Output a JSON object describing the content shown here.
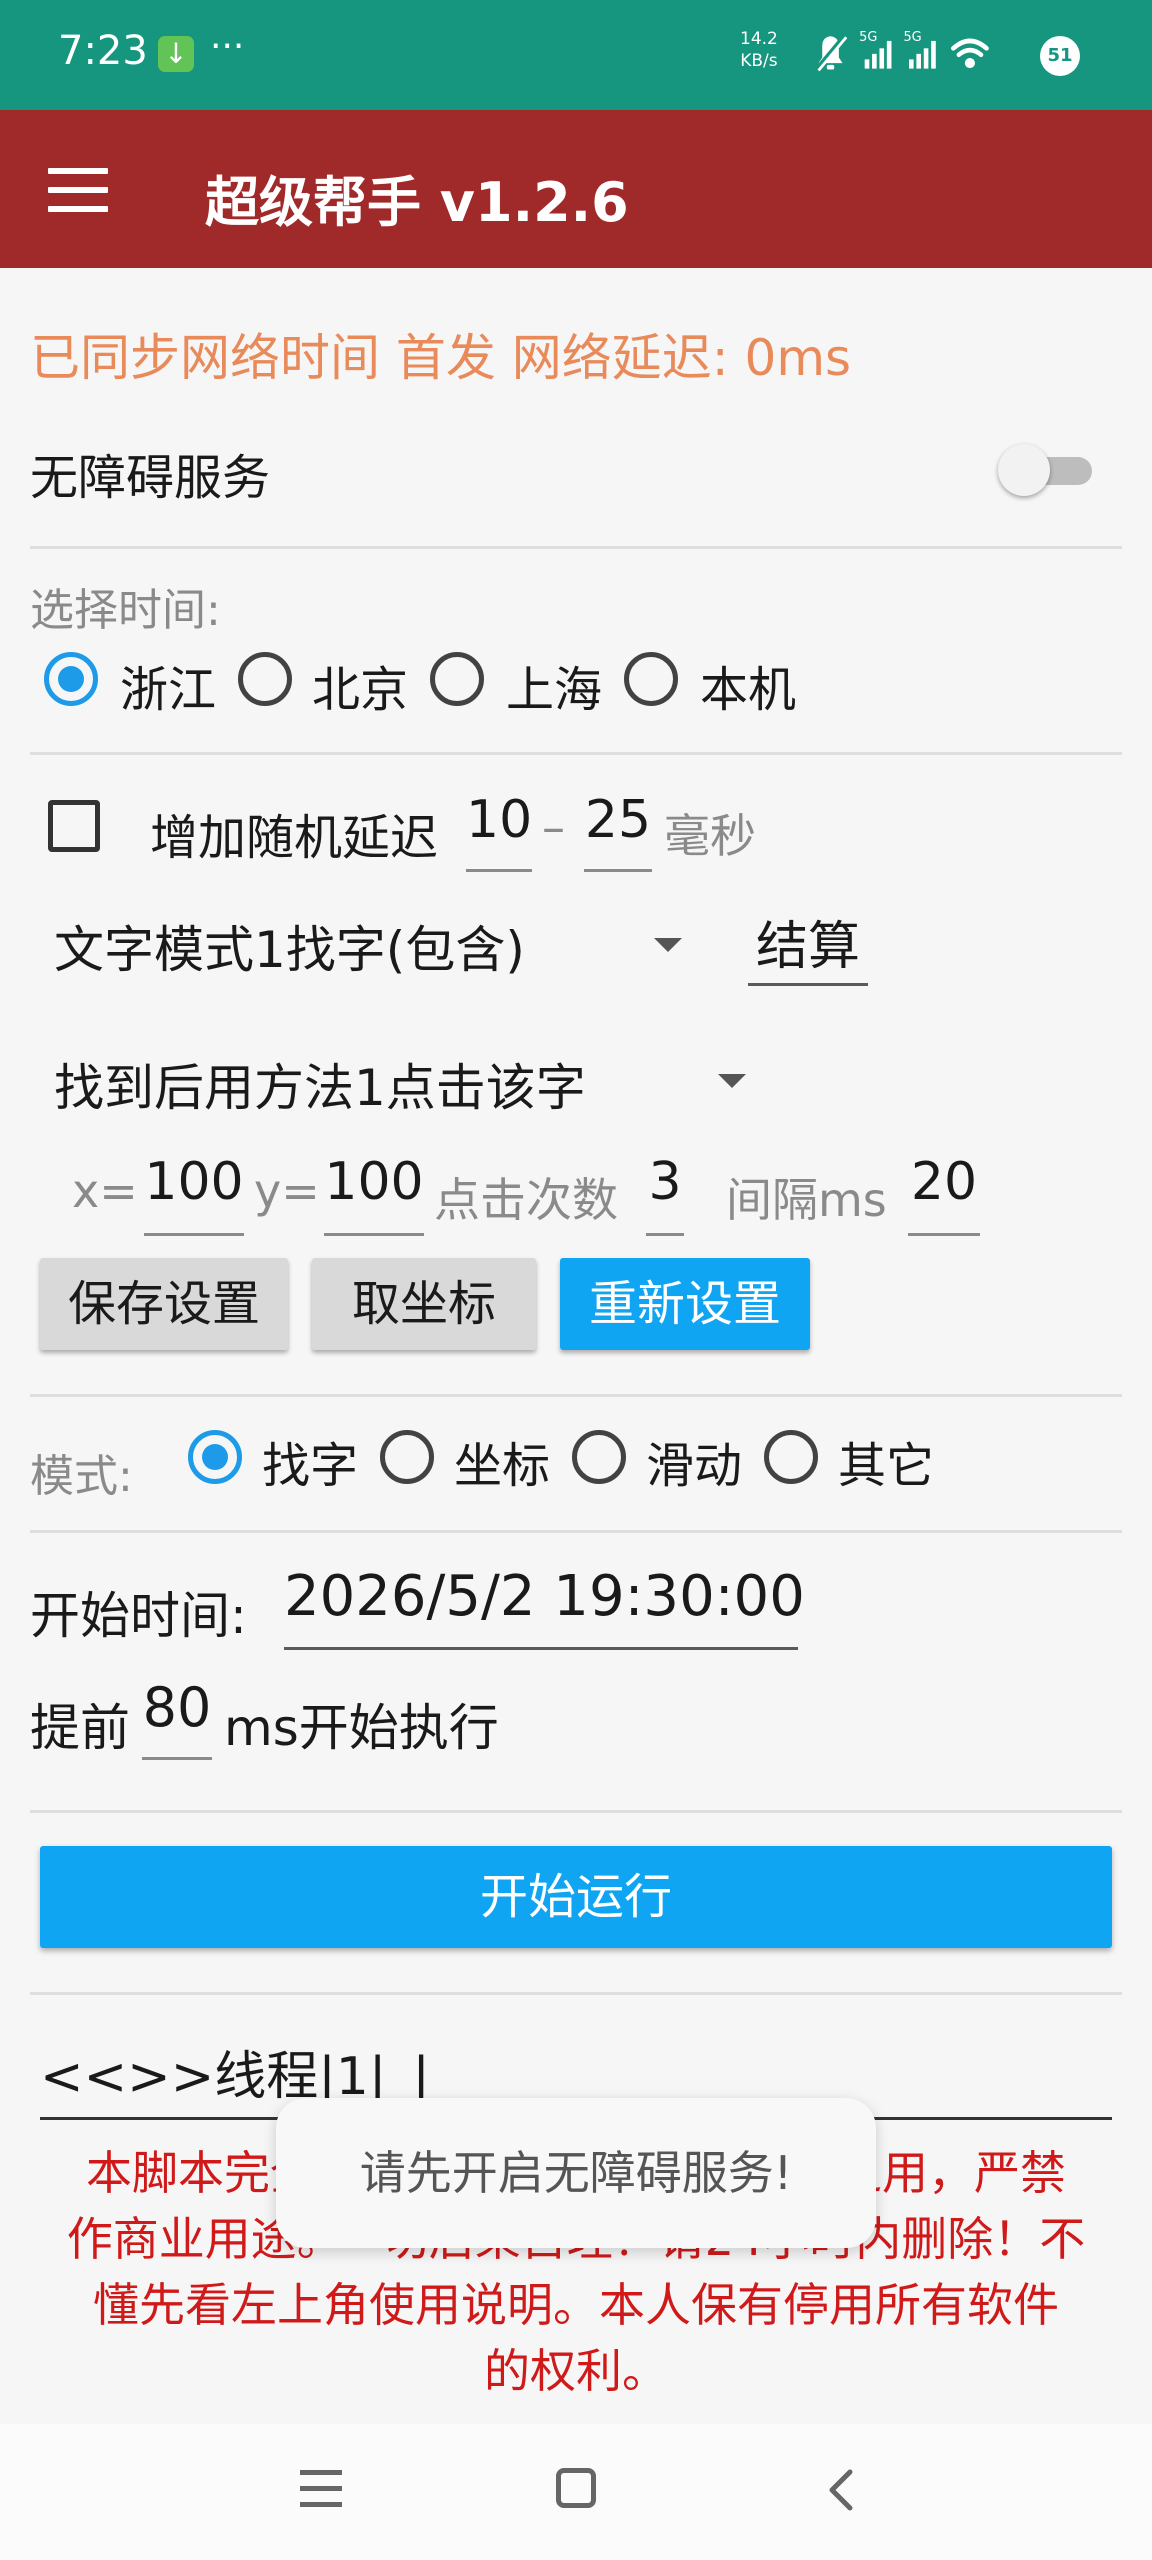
{
  "status_bar": {
    "time": "7:23",
    "dots": "···",
    "net_speed_value": "14.2",
    "net_speed_unit": "KB/s",
    "signal_label_1": "5G",
    "signal_label_2": "5G",
    "notification_count": "51"
  },
  "app_bar": {
    "title": "超级帮手 v1.2.6"
  },
  "sync_status": "已同步网络时间 首发 网络延迟: 0ms",
  "accessibility": {
    "label": "无障碍服务",
    "enabled": false
  },
  "time_source": {
    "label": "选择时间:",
    "options": [
      "浙江",
      "北京",
      "上海",
      "本机"
    ],
    "selected": "浙江"
  },
  "random_delay": {
    "checked": false,
    "label": "增加随机延迟",
    "min": "10",
    "separator": "–",
    "max": "25",
    "unit": "毫秒"
  },
  "text_mode": {
    "selected": "文字模式1找字(包含)",
    "settle_value": "结算"
  },
  "click_method": {
    "selected": "找到后用方法1点击该字"
  },
  "coords": {
    "x_label": "x=",
    "x_value": "100",
    "y_label": "y=",
    "y_value": "100",
    "count_label": "点击次数",
    "count_value": "3",
    "interval_label": "间隔ms",
    "interval_value": "20"
  },
  "buttons": {
    "save": "保存设置",
    "get_coords": "取坐标",
    "reset": "重新设置"
  },
  "mode": {
    "label": "模式:",
    "options": [
      "找字",
      "坐标",
      "滑动",
      "其它"
    ],
    "selected": "找字"
  },
  "start_time": {
    "label": "开始时间:",
    "value": "2026/5/2 19:30:00"
  },
  "advance": {
    "prefix": "提前",
    "value": "80",
    "suffix": "ms开始执行"
  },
  "start_button": "开始运行",
  "log_text": "<<>>线程|1|_|",
  "disclaimer_lines": [
    "本脚本完全",
    "之用，严禁",
    "作商业用途。",
    "切后果自理！请24小时内删除！不",
    "懂先看左上角使用说明。本人保有停用所有软件",
    "的权利。"
  ],
  "toast": "请先开启无障碍服务!",
  "colors": {
    "status_bar": "#16967f",
    "app_bar": "#a0292a",
    "accent_blue": "#10a5f2",
    "sync_text": "#e88a5a",
    "disclaimer_red": "#d01a1a"
  }
}
